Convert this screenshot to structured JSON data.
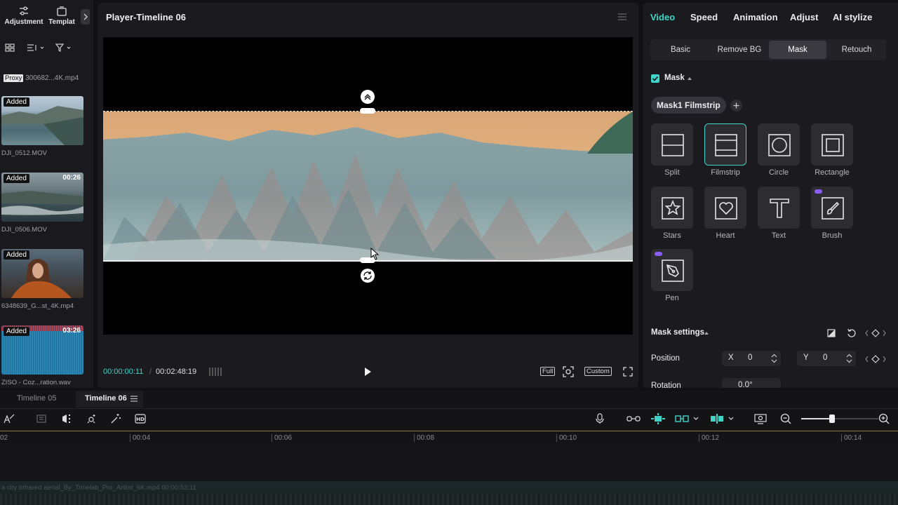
{
  "left_panel": {
    "adjustment_label": "Adjustment",
    "template_label": "Templat",
    "proxy_badge": "Proxy",
    "proxy_file": "300682...4K.mp4",
    "media": [
      {
        "added": "Added",
        "duration": "",
        "name": "DJI_0512.MOV"
      },
      {
        "added": "Added",
        "duration": "00:26",
        "name": "DJI_0506.MOV"
      },
      {
        "added": "Added",
        "duration": "",
        "name": "6348639_G...st_4K.mp4"
      },
      {
        "added": "Added",
        "duration": "03:26",
        "name": "ZISO - Coz...ration.wav"
      }
    ]
  },
  "player": {
    "title": "Player-Timeline 06",
    "current_time": "00:00:00:11",
    "separator": "/",
    "total_time": "00:02:48:19",
    "full_label": "Full",
    "custom_label": "Custom"
  },
  "right_panel": {
    "tabs": [
      "Video",
      "Speed",
      "Animation",
      "Adjust",
      "AI stylize"
    ],
    "subtabs": [
      "Basic",
      "Remove BG",
      "Mask",
      "Retouch"
    ],
    "mask_section_label": "Mask",
    "mask_chip": "Mask1 Filmstrip",
    "shapes": [
      "Split",
      "Filmstrip",
      "Circle",
      "Rectangle",
      "Stars",
      "Heart",
      "Text",
      "Brush",
      "Pen"
    ],
    "mask_settings_label": "Mask settings",
    "position_label": "Position",
    "x_label": "X",
    "x_value": "0",
    "y_label": "Y",
    "y_value": "0",
    "rotation_label": "Rotation",
    "rotation_value": "0.0°"
  },
  "timeline": {
    "tabs": [
      "Timeline 05",
      "Timeline 06"
    ],
    "ruler": [
      "02",
      "00:04",
      "00:06",
      "00:08",
      "00:10",
      "00:12",
      "00:14"
    ],
    "clip_label": "a city Infrared aerial_By_Timelab_Pro_Artlist_6K.mp4   00:00:53:11"
  },
  "colors": {
    "accent": "#3fd6c9",
    "panel": "#1b1b1f",
    "brush_badge": "#8b5cf6"
  }
}
